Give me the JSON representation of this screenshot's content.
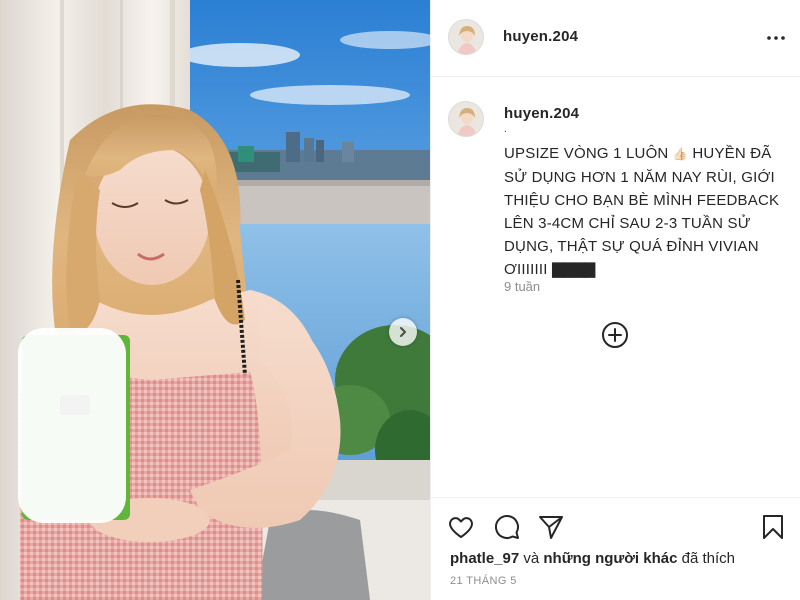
{
  "post": {
    "username": "huyen.204",
    "caption_author": "huyen.204",
    "caption_marker": ".",
    "caption_text": "UPSIZE VÒNG 1 LUÔN",
    "caption_emoji": "👍🏻",
    "caption_text_rest": "HUYỀN ĐÃ SỬ DỤNG HƠN 1 NĂM NAY RÙI, GIỚI THIỆU CHO BẠN BÈ MÌNH FEEDBACK LÊN 3-4CM CHỈ SAU 2-3 TUẦN SỬ DỤNG, THẬT SỰ QUÁ ĐỈNH VIVIAN ƠIIIIIII",
    "caption_bars": "▇▇▇▇",
    "time_ago": "9 tuần",
    "liked_by_user": "phatle_97",
    "liked_by_and": "và",
    "liked_by_others": "những người khác",
    "liked_by_suffix": "đã thích",
    "date": "21 THÁNG 5"
  },
  "icons": {
    "more": "more-options-icon",
    "load_more": "plus-circle-icon",
    "like": "heart-icon",
    "comment": "comment-icon",
    "share": "share-icon",
    "save": "bookmark-icon",
    "carousel_next": "chevron-right-icon"
  },
  "colors": {
    "text": "#262626",
    "muted": "#8e8e8e",
    "border": "#efefef",
    "product_green": "#5fb63a"
  }
}
